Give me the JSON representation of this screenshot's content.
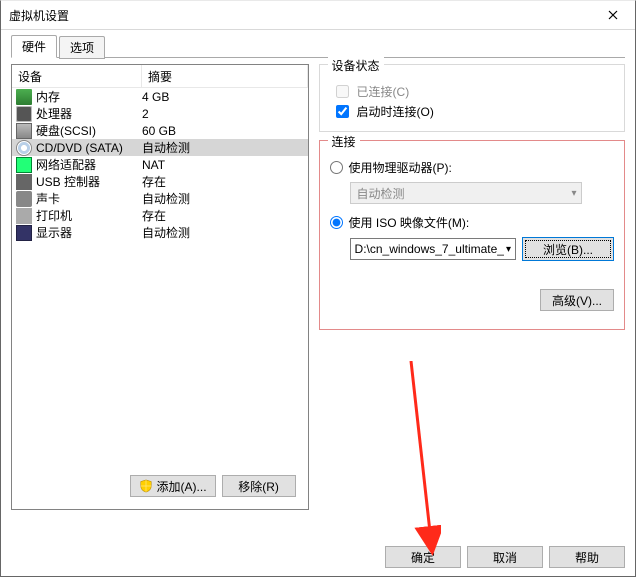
{
  "window": {
    "title": "虚拟机设置"
  },
  "tabs": {
    "hardware": "硬件",
    "options": "选项"
  },
  "cols": {
    "device": "设备",
    "summary": "摘要"
  },
  "devices": [
    {
      "name": "内存",
      "summary": "4 GB"
    },
    {
      "name": "处理器",
      "summary": "2"
    },
    {
      "name": "硬盘(SCSI)",
      "summary": "60 GB"
    },
    {
      "name": "CD/DVD (SATA)",
      "summary": "自动检测"
    },
    {
      "name": "网络适配器",
      "summary": "NAT"
    },
    {
      "name": "USB 控制器",
      "summary": "存在"
    },
    {
      "name": "声卡",
      "summary": "自动检测"
    },
    {
      "name": "打印机",
      "summary": "存在"
    },
    {
      "name": "显示器",
      "summary": "自动检测"
    }
  ],
  "dev_buttons": {
    "add": "添加(A)...",
    "remove": "移除(R)"
  },
  "status_group": {
    "legend": "设备状态",
    "connected": "已连接(C)",
    "connect_at_poweron": "启动时连接(O)"
  },
  "conn_group": {
    "legend": "连接",
    "use_physical": "使用物理驱动器(P):",
    "auto_detect": "自动检测",
    "use_iso": "使用 ISO 映像文件(M):",
    "iso_path": "D:\\cn_windows_7_ultimate_",
    "browse": "浏览(B)...",
    "advanced": "高级(V)..."
  },
  "dlg": {
    "ok": "确定",
    "cancel": "取消",
    "help": "帮助"
  }
}
